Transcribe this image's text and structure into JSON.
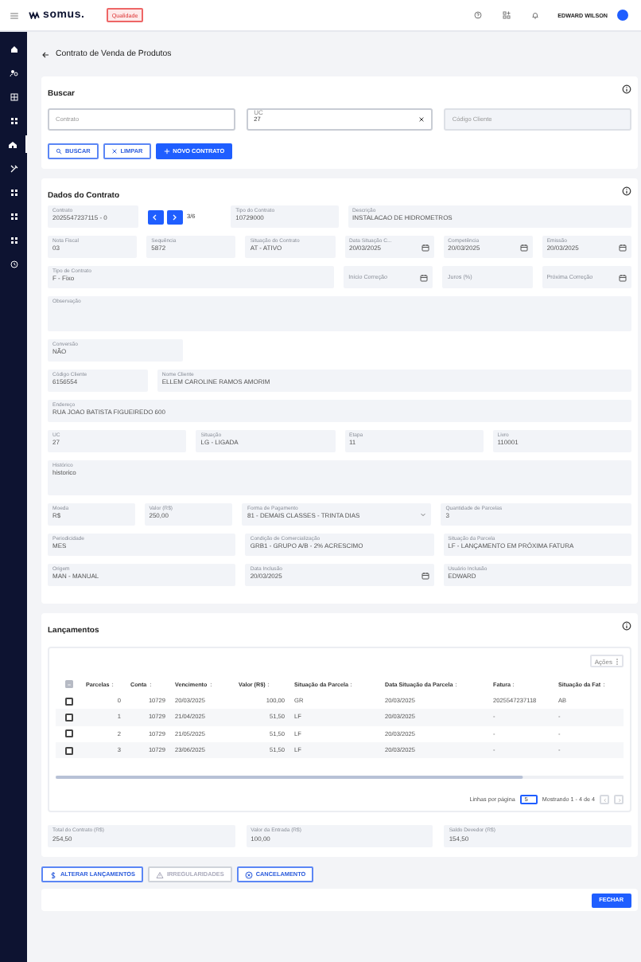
{
  "header": {
    "logo": "somus.",
    "env_badge": "Qualidade",
    "user": "EDWARD WILSON"
  },
  "sidebar": {
    "items": [
      {
        "selected": false
      },
      {
        "selected": false
      },
      {
        "selected": false
      },
      {
        "selected": false
      },
      {
        "selected": true
      },
      {
        "selected": false
      },
      {
        "selected": false
      },
      {
        "selected": false
      },
      {
        "selected": false
      },
      {
        "selected": false
      }
    ]
  },
  "page_title": "Contrato de Venda de Produtos",
  "search": {
    "title": "Buscar",
    "fields": [
      {
        "kind": "input",
        "placeholder": "Contrato"
      },
      {
        "kind": "input",
        "label": "UC",
        "value": "27",
        "clearable": true
      },
      {
        "kind": "disabled",
        "placeholder": "Código Cliente"
      }
    ],
    "buttons": [
      {
        "label": "BUSCAR",
        "kind": "outline"
      },
      {
        "label": "LIMPAR",
        "kind": "outline"
      },
      {
        "label": "NOVO CONTRATO",
        "kind": "primary"
      }
    ]
  },
  "contract": {
    "title": "Dados do Contrato",
    "lines": [
      {
        "fields": [
          {
            "kind": "text",
            "label": "Contrato",
            "value": "2025547237115 - 0"
          },
          {
            "kind": "pager",
            "text": "3/6"
          },
          {
            "kind": "text",
            "label": "Tipo do Contrato",
            "value": "10729000"
          },
          {
            "kind": "text",
            "label": "Descrição",
            "value": "INSTALACAO DE HIDROMETROS"
          }
        ]
      },
      {
        "fields": [
          {
            "kind": "text",
            "label": "Nota Fiscal",
            "value": "03"
          },
          {
            "kind": "text",
            "label": "Sequência",
            "value": "5872"
          },
          {
            "kind": "text",
            "label": "Situação do Contrato",
            "value": "AT - ATIVO"
          },
          {
            "kind": "date",
            "label": "Data Situação C...",
            "value": "20/03/2025"
          },
          {
            "kind": "date",
            "label": "Competência",
            "value": "20/03/2025"
          },
          {
            "kind": "date",
            "label": "Emissão",
            "value": "20/03/2025"
          }
        ]
      },
      {
        "fields": [
          {
            "kind": "text",
            "label": "Tipo de Contrato",
            "value": "F - Fixo"
          },
          {
            "kind": "date",
            "placeholder": "Início Correção"
          },
          {
            "kind": "text",
            "placeholder": "Juros (%)"
          },
          {
            "kind": "date",
            "placeholder": "Próxima Correção"
          }
        ]
      },
      {
        "fields": [
          {
            "kind": "textarea",
            "label": "Observação"
          }
        ]
      },
      {
        "fields": [
          {
            "kind": "text",
            "label": "Conversão",
            "value": "NÃO"
          }
        ]
      },
      {
        "fields": [
          {
            "kind": "text",
            "label": "Código Cliente",
            "value": "6156554"
          },
          {
            "kind": "text",
            "label": "Nome Cliente",
            "value": "ELLEM CAROLINE RAMOS AMORIM"
          }
        ]
      },
      {
        "fields": [
          {
            "kind": "text",
            "label": "Endereço",
            "value": "RUA JOAO BATISTA FIGUEIREDO 600"
          }
        ]
      },
      {
        "fields": [
          {
            "kind": "text",
            "label": "UC",
            "value": "27"
          },
          {
            "kind": "text",
            "label": "Situação",
            "value": "LG - LIGADA"
          },
          {
            "kind": "text",
            "label": "Etapa",
            "value": "11"
          },
          {
            "kind": "text",
            "label": "Livro",
            "value": "110001"
          }
        ]
      },
      {
        "fields": [
          {
            "kind": "textarea",
            "label": "Histórico",
            "value": "historico"
          }
        ]
      },
      {
        "fields": [
          {
            "kind": "text",
            "label": "Moeda",
            "value": "R$"
          },
          {
            "kind": "text",
            "label": "Valor (R$)",
            "value": "250,00"
          },
          {
            "kind": "select",
            "label": "Forma de Pagamento",
            "value": "81 - DEMAIS CLASSES - TRINTA DIAS"
          },
          {
            "kind": "text",
            "label": "Quantidade de Parcelas",
            "value": "3"
          }
        ]
      },
      {
        "fields": [
          {
            "kind": "text",
            "label": "Periodicidade",
            "value": "MES"
          },
          {
            "kind": "text",
            "label": "Condição de Comercialização",
            "value": "GRB1 - GRUPO A/B - 2% ACRESCIMO"
          },
          {
            "kind": "text",
            "label": "Situação da Parcela",
            "value": "LF - LANÇAMENTO EM PRÓXIMA FATURA"
          }
        ]
      },
      {
        "fields": [
          {
            "kind": "text",
            "label": "Origem",
            "value": "MAN - MANUAL"
          },
          {
            "kind": "date",
            "label": "Data Inclusão",
            "value": "20/03/2025"
          },
          {
            "kind": "text",
            "label": "Usuário Inclusão",
            "value": "EDWARD"
          }
        ]
      }
    ]
  },
  "entries": {
    "title": "Lançamentos",
    "actions_button": "Ações",
    "select_all": {
      "disabled": true
    },
    "columns": [
      "Parcelas",
      "Conta",
      "Vencimento",
      "Valor (R$)",
      "Situação da Parcela",
      "Data Situação da Parcela",
      "Fatura",
      "Situação da Fat"
    ],
    "rows": [
      {
        "selected": false,
        "cells": [
          "0",
          "10729",
          "20/03/2025",
          "100,00",
          "GR",
          "20/03/2025",
          "2025547237118",
          "AB"
        ]
      },
      {
        "selected": false,
        "cells": [
          "1",
          "10729",
          "21/04/2025",
          "51,50",
          "LF",
          "20/03/2025",
          "-",
          "-"
        ]
      },
      {
        "selected": false,
        "cells": [
          "2",
          "10729",
          "21/05/2025",
          "51,50",
          "LF",
          "20/03/2025",
          "-",
          "-"
        ]
      },
      {
        "selected": false,
        "cells": [
          "3",
          "10729",
          "23/06/2025",
          "51,50",
          "LF",
          "20/03/2025",
          "-",
          "-"
        ]
      }
    ],
    "rows_per_page_label": "Linhas por página",
    "rows_per_page": "5",
    "range": "Mostrando 1 - 4 de 4",
    "totals": [
      {
        "kind": "text",
        "label": "Total do Contrato (R$)",
        "value": "254,50"
      },
      {
        "kind": "text",
        "label": "Valor da Entrada (R$)",
        "value": "100,00"
      },
      {
        "kind": "text",
        "label": "Saldo Devedor (R$)",
        "value": "154,50"
      }
    ]
  },
  "actions": [
    {
      "label": "ALTERAR LANÇAMENTOS",
      "disabled": false
    },
    {
      "label": "IRREGULARIDADES",
      "disabled": true
    },
    {
      "label": "CANCELAMENTO",
      "disabled": false
    }
  ],
  "footer": {
    "close_button": "FECHAR"
  }
}
